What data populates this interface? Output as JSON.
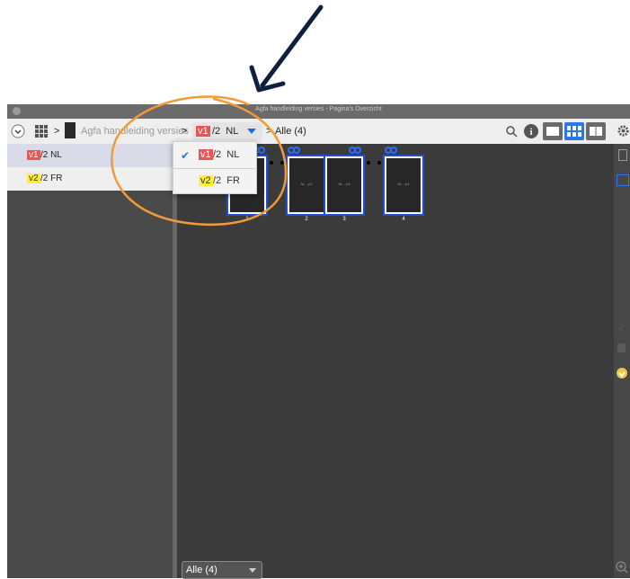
{
  "window": {
    "title": "Agfa handleiding versies - Pagina's Overzicht"
  },
  "toolbar": {
    "separator": ">",
    "document_name": "Agfa handleiding versies",
    "version_chip": "v1",
    "version_suffix": "/2  NL",
    "filter_label": "Alle (4)"
  },
  "sidebar": {
    "items": [
      {
        "chip": "v1",
        "label": "/2 NL",
        "chip_color": "#e85656"
      },
      {
        "chip": "v2",
        "label": "/2 FR",
        "chip_color": "#ffee3a"
      }
    ]
  },
  "dropdown": {
    "items": [
      {
        "chip": "v1",
        "label": "/2  NL",
        "checked": true
      },
      {
        "chip": "v2",
        "label": "/2  FR",
        "checked": false
      }
    ]
  },
  "pages": [
    {
      "number": "1",
      "label": ""
    },
    {
      "number": "2",
      "label": "NL - p2"
    },
    {
      "number": "3",
      "label": "NL - p3"
    },
    {
      "number": "4",
      "label": "NL - p4"
    }
  ],
  "filter": {
    "value": "Alle (4)"
  },
  "colors": {
    "accent": "#1d4fd8",
    "annotation": "#f29a38",
    "arrow": "#0f1f3d"
  }
}
